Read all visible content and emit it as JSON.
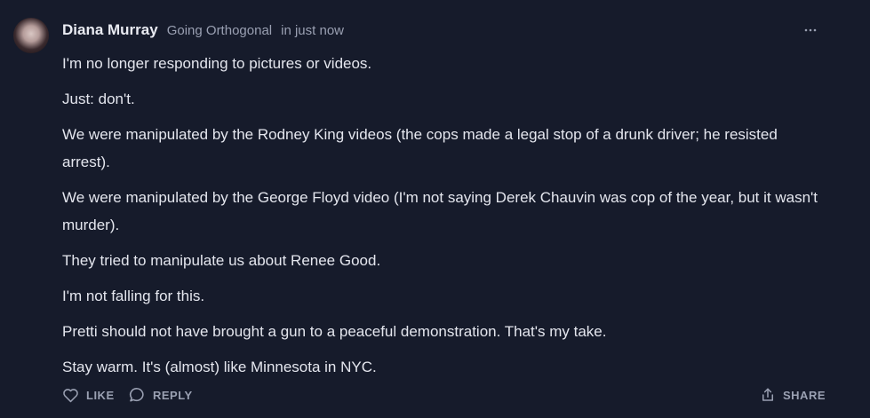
{
  "comment": {
    "author": "Diana Murray",
    "publication": "Going Orthogonal",
    "timestamp": "in just now",
    "more_icon": "more-horizontal-icon",
    "paragraphs": [
      "I'm no longer responding to pictures or videos.",
      "Just: don't.",
      "We were manipulated by the Rodney King videos (the cops made a legal stop of a drunk driver; he resisted arrest).",
      "We were manipulated by the George Floyd video (I'm not saying Derek Chauvin was cop of the year, but it wasn't murder).",
      "They tried to manipulate us about Renee Good.",
      "I'm not falling for this.",
      "Pretti should not have brought a gun to a peaceful demonstration. That's my take.",
      "Stay warm. It's (almost) like Minnesota in NYC."
    ],
    "actions": {
      "like_label": "LIKE",
      "reply_label": "REPLY",
      "share_label": "SHARE"
    }
  },
  "colors": {
    "background": "#161b2b",
    "text": "#e4e6ee",
    "muted": "#9aa0b2"
  }
}
